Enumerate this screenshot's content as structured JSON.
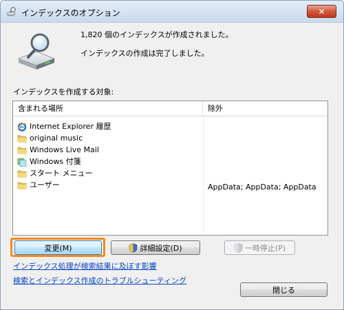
{
  "window": {
    "title": "インデックスのオプション",
    "close_label": "✕"
  },
  "summary": {
    "count_text": "1,820 個のインデックスが作成されました。",
    "status_text": "インデックスの作成は完了しました。"
  },
  "section_label": "インデックスを作成する対象:",
  "table": {
    "headers": {
      "location": "含まれる場所",
      "exclude": "除外"
    },
    "rows": [
      {
        "icon": "internet-explorer-icon",
        "label": "Internet Explorer 履歴",
        "exclude": ""
      },
      {
        "icon": "folder-icon",
        "label": "original music",
        "exclude": ""
      },
      {
        "icon": "folder-icon",
        "label": "Windows Live Mail",
        "exclude": ""
      },
      {
        "icon": "sticky-notes-icon",
        "label": "Windows 付箋",
        "exclude": ""
      },
      {
        "icon": "folder-icon",
        "label": "スタート メニュー",
        "exclude": ""
      },
      {
        "icon": "folder-icon",
        "label": "ユーザー",
        "exclude": "AppData; AppData; AppData"
      }
    ]
  },
  "buttons": {
    "modify": "変更(M)",
    "advanced": "詳細設定(D)",
    "pause": "一時停止(P)",
    "close": "閉じる"
  },
  "links": {
    "impact": "インデックス処理が検索結果に及ぼす影響",
    "troubleshoot": "検索とインデックス作成のトラブルシューティング"
  },
  "colors": {
    "focus_ring": "#f68a1e",
    "link": "#0645c8",
    "close_button": "#c0391d"
  }
}
